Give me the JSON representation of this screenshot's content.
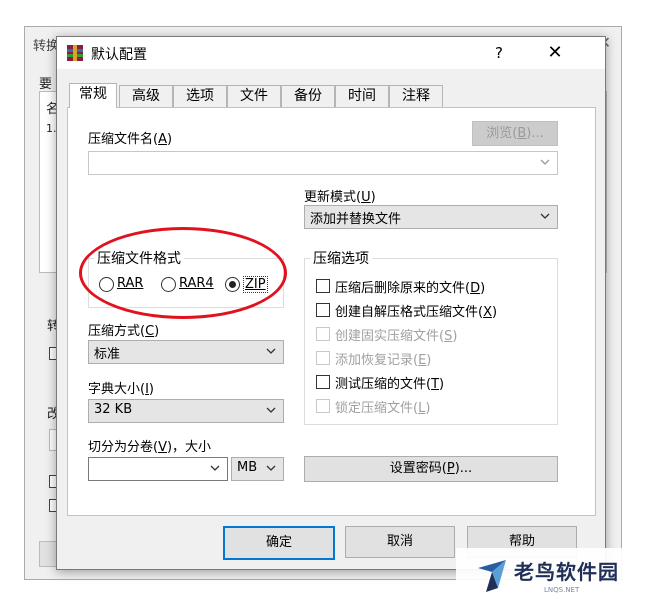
{
  "background_window": {
    "title_fragment": "转换",
    "label_fragment": "要",
    "list_fragments": [
      "名",
      "1."
    ],
    "side_fragments": [
      "转",
      "改"
    ]
  },
  "dialog": {
    "title": "默认配置",
    "help_glyph": "?",
    "close_glyph": "✕",
    "tabs": [
      {
        "label": "常规",
        "active": true
      },
      {
        "label": "高级",
        "active": false
      },
      {
        "label": "选项",
        "active": false
      },
      {
        "label": "文件",
        "active": false
      },
      {
        "label": "备份",
        "active": false
      },
      {
        "label": "时间",
        "active": false
      },
      {
        "label": "注释",
        "active": false
      }
    ],
    "archive_name": {
      "label": "压缩文件名(",
      "hotkey": "A",
      "close": ")",
      "value": "",
      "browse": {
        "label": "浏览(",
        "hotkey": "B",
        "close": ")..."
      }
    },
    "update_mode": {
      "label": "更新模式(",
      "hotkey": "U",
      "close": ")",
      "value": "添加并替换文件"
    },
    "format": {
      "title": "压缩文件格式",
      "options": [
        {
          "label": "RAR",
          "selected": false
        },
        {
          "label": "RAR4",
          "selected": false
        },
        {
          "label": "ZIP",
          "selected": true
        }
      ]
    },
    "method": {
      "label": "压缩方式(",
      "hotkey": "C",
      "close": ")",
      "value": "标准"
    },
    "dictionary": {
      "label": "字典大小(",
      "hotkey": "I",
      "close": ")",
      "value": "32 KB"
    },
    "split": {
      "label": "切分为分卷(",
      "hotkey": "V",
      "close": ")，大小",
      "value": "",
      "unit": "MB"
    },
    "options": {
      "title": "压缩选项",
      "items": [
        {
          "label": "压缩后删除原来的文件(",
          "hotkey": "D",
          "close": ")",
          "checked": false,
          "enabled": true
        },
        {
          "label": "创建自解压格式压缩文件(",
          "hotkey": "X",
          "close": ")",
          "checked": false,
          "enabled": true
        },
        {
          "label": "创建固实压缩文件(",
          "hotkey": "S",
          "close": ")",
          "checked": false,
          "enabled": false
        },
        {
          "label": "添加恢复记录(",
          "hotkey": "E",
          "close": ")",
          "checked": false,
          "enabled": false
        },
        {
          "label": "测试压缩的文件(",
          "hotkey": "T",
          "close": ")",
          "checked": false,
          "enabled": true
        },
        {
          "label": "锁定压缩文件(",
          "hotkey": "L",
          "close": ")",
          "checked": false,
          "enabled": false
        }
      ]
    },
    "password_button": {
      "label": "设置密码(",
      "hotkey": "P",
      "close": ")..."
    },
    "buttons": {
      "ok": "确定",
      "cancel": "取消",
      "help": "帮助"
    }
  },
  "watermark": {
    "text": "老鸟软件园",
    "sub": "LNQS.NET"
  },
  "colors": {
    "highlight_ellipse": "#e0121e",
    "dialog_bg": "#f0f0f0",
    "page_bg": "#ffffff"
  }
}
